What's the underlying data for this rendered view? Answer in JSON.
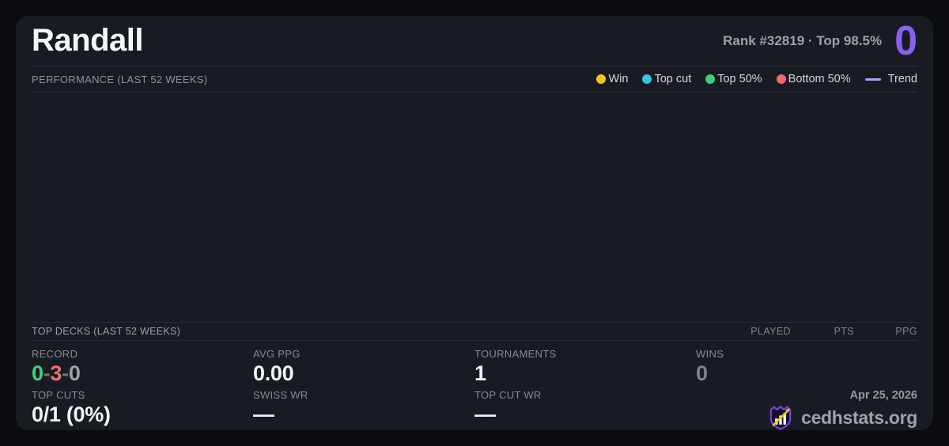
{
  "header": {
    "title": "Randall",
    "rank_text": "Rank #32819 · Top 98.5%",
    "score": "0"
  },
  "performance": {
    "label": "PERFORMANCE (LAST 52 WEEKS)",
    "legend": [
      {
        "label": "Win",
        "color": "#f3c41e"
      },
      {
        "label": "Top cut",
        "color": "#2ec8e6"
      },
      {
        "label": "Top 50%",
        "color": "#3ccb7f"
      },
      {
        "label": "Bottom 50%",
        "color": "#f3696f"
      }
    ],
    "trend_label": "Trend",
    "trend_color": "#b49cf8",
    "chart_empty": true
  },
  "top_decks": {
    "label": "TOP DECKS (LAST 52 WEEKS)",
    "columns": {
      "played": "PLAYED",
      "pts": "PTS",
      "ppg": "PPG"
    },
    "rows": []
  },
  "stats": {
    "record": {
      "label": "RECORD",
      "wins": "0",
      "losses": "3",
      "draws": "0",
      "separator": "-"
    },
    "avg_ppg": {
      "label": "AVG PPG",
      "value": "0.00"
    },
    "tournaments": {
      "label": "TOURNAMENTS",
      "value": "1"
    },
    "wins": {
      "label": "WINS",
      "value": "0"
    },
    "top_cuts": {
      "label": "TOP CUTS",
      "value": "0/1 (0%)"
    },
    "swiss_wr": {
      "label": "SWISS WR",
      "value": "—"
    },
    "top_cut_wr": {
      "label": "TOP CUT WR",
      "value": "—"
    }
  },
  "footer": {
    "date": "Apr 25, 2026",
    "site": "cedhstats.org"
  },
  "colors": {
    "accent_purple": "#8a5ff2",
    "win_green": "#44cf7c",
    "loss_red": "#f47171",
    "draw_gray": "#9aa1ad",
    "separator_gray": "#6c7380",
    "card_bg": "#191b23",
    "page_bg": "#0b0c0f",
    "logo_purple": "#7a3ff0",
    "logo_gold": "#f2c41e"
  }
}
